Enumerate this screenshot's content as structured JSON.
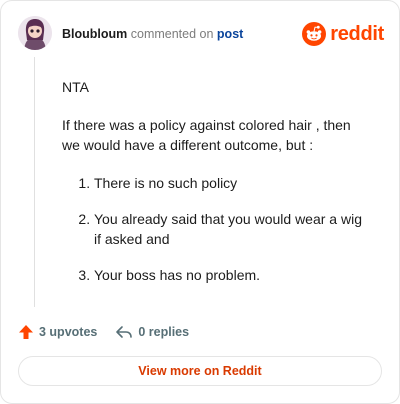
{
  "header": {
    "author": "Bloubloum",
    "action_text": "commented on",
    "post_link": "post",
    "brand": "reddit"
  },
  "comment": {
    "paragraphs": [
      "NTA",
      "If there was a policy against colored hair , then we would have a different outcome, but :"
    ],
    "list": [
      "There is no such policy",
      "You already said that you would wear a wig if asked and",
      "Your boss has no problem."
    ]
  },
  "actions": {
    "upvotes": "3 upvotes",
    "replies": "0 replies"
  },
  "footer": {
    "button_label": "View more on Reddit"
  },
  "colors": {
    "brand": "#ff4500",
    "link": "#0a449b",
    "button_text": "#d93a00"
  },
  "icons": [
    "avatar",
    "reddit-logo-icon",
    "upvote-arrow-icon",
    "reply-arrow-icon"
  ]
}
